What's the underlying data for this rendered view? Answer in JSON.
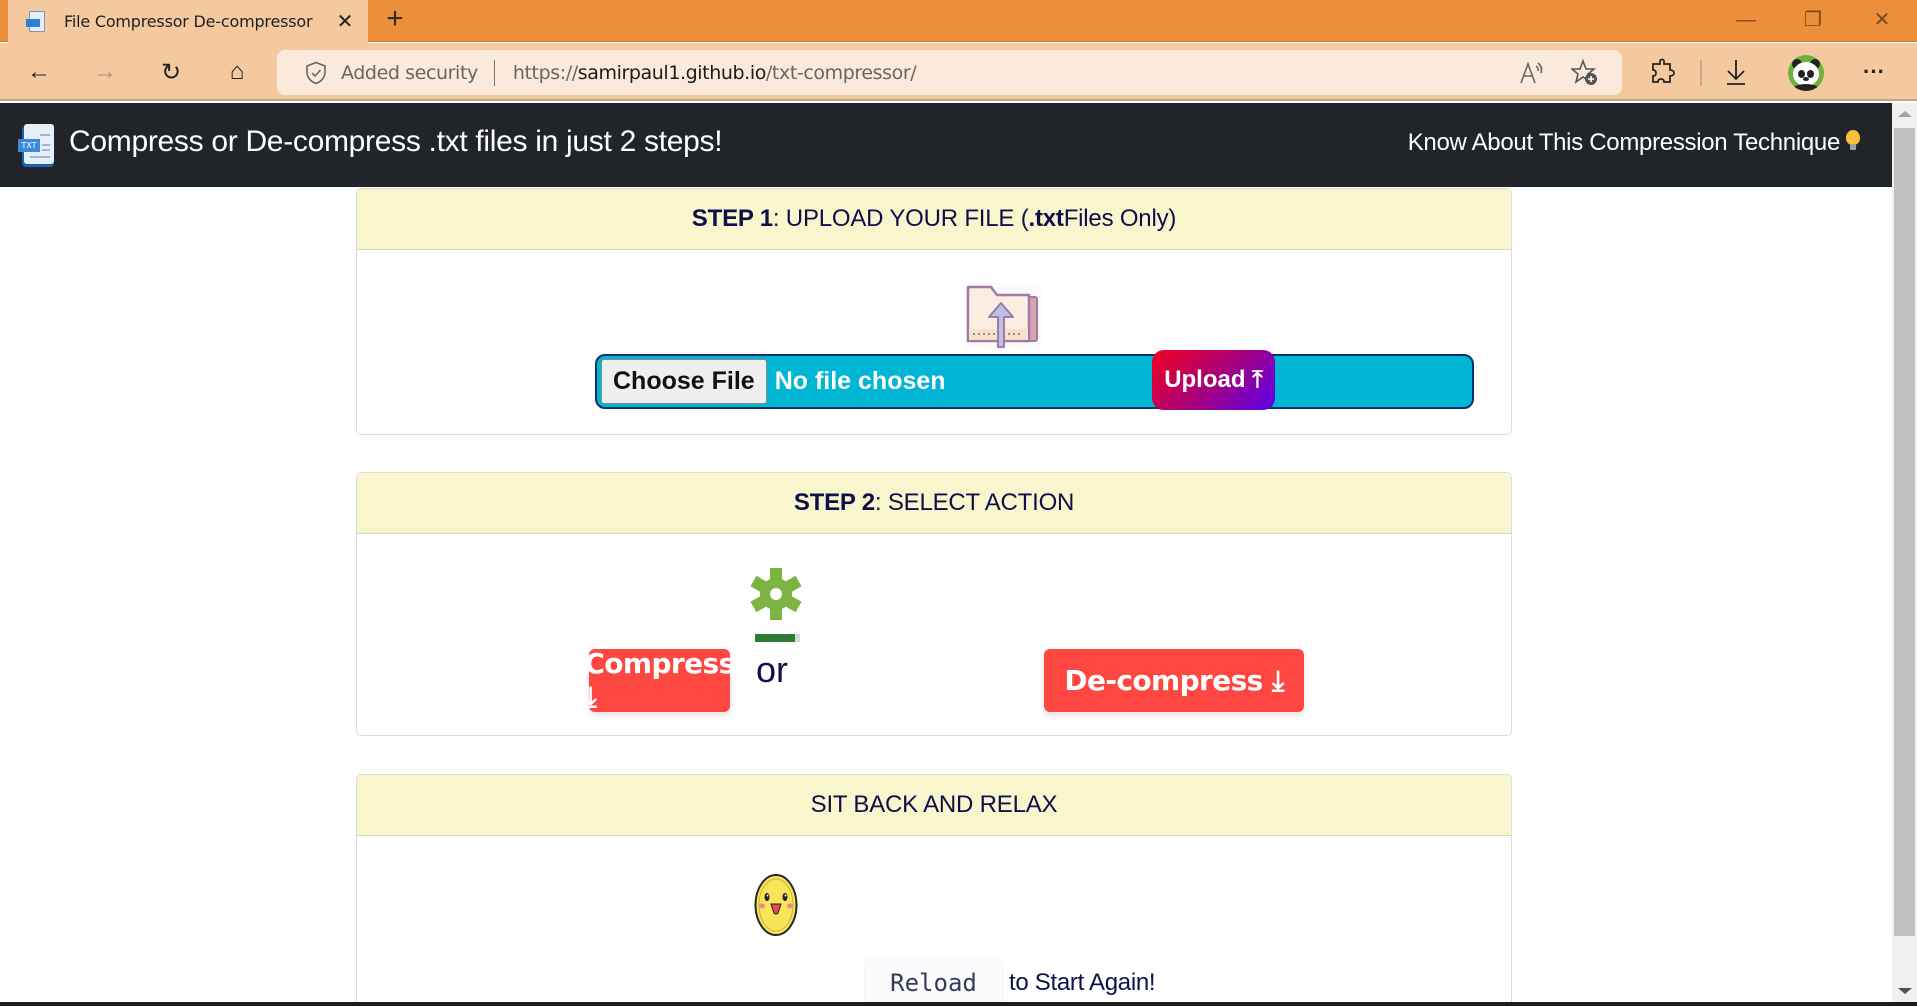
{
  "browser": {
    "tab": {
      "title": "File Compressor De-compressor",
      "favicon": "txt-file-icon"
    },
    "new_tab_label": "+",
    "window_controls": {
      "minimize": "—",
      "restore": "❐",
      "close": "✕"
    },
    "nav": {
      "back": "←",
      "forward": "→",
      "refresh": "↻",
      "home": "⌂"
    },
    "address_bar": {
      "security_label": "Added security",
      "url_prefix": "https://",
      "url_host": "samirpaul1.github.io",
      "url_path": "/txt-compressor/"
    },
    "toolbar_icons": [
      "read-aloud-icon",
      "add-favorite-icon",
      "extensions-icon",
      "downloads-icon",
      "profile-avatar",
      "more-menu-icon"
    ],
    "more_label": "···"
  },
  "page": {
    "navbar": {
      "brand": "Compress or De-compress .txt files in just 2 steps!",
      "link": "Know About This Compression Technique"
    },
    "step1": {
      "title_bold": "STEP 1",
      "title_rest": ": UPLOAD YOUR FILE (",
      "title_ext": ".txt",
      "title_tail": " Files Only)",
      "choose_file_label": "Choose File",
      "file_status": "No file chosen",
      "upload_label": "Upload ⤒"
    },
    "step2": {
      "title_bold": "STEP 2",
      "title_rest": ": SELECT ACTION",
      "processing_progress": 0.88,
      "compress_label": "Compress ⤓",
      "or_label": "or",
      "decompress_label": "De-compress ⤓"
    },
    "step3": {
      "title": "SIT BACK AND RELAX",
      "reload_label": "Reload",
      "reload_tail": "to Start Again!"
    }
  },
  "colors": {
    "tabstrip": "#eb8f3a",
    "toolbar": "#f5c9a0",
    "navbar": "#212529",
    "card_header": "#f9f6cd",
    "file_input": "#01b5d5",
    "action_button": "#ff4742"
  }
}
